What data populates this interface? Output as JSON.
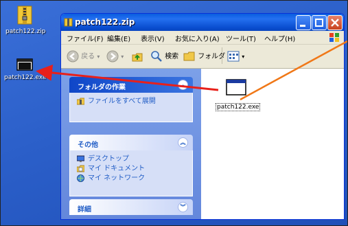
{
  "desktop": {
    "icons": [
      {
        "label": "patch122.zip",
        "icon": "zip-folder-icon"
      },
      {
        "label": "patch122.exe",
        "icon": "exe-program-icon"
      }
    ]
  },
  "window": {
    "title": "patch122.zip",
    "menu": [
      "ファイル(F)",
      "編集(E)",
      "表示(V)",
      "お気に入り(A)",
      "ツール(T)",
      "ヘルプ(H)"
    ],
    "toolbar": {
      "back_label": "戻る",
      "search_label": "検索",
      "folders_label": "フォルダ"
    },
    "taskpane": {
      "folder_tasks": {
        "title": "フォルダの作業",
        "items": [
          "ファイルをすべて展開"
        ]
      },
      "other": {
        "title": "その他",
        "items": [
          "デスクトップ",
          "マイ ドキュメント",
          "マイ ネットワーク"
        ]
      },
      "details": {
        "title": "詳細"
      }
    },
    "file": {
      "label": "patch122.exe",
      "icon": "exe-program-icon"
    }
  },
  "annotations": {
    "arrow_colors": [
      "#e8201a",
      "#f07818"
    ]
  }
}
